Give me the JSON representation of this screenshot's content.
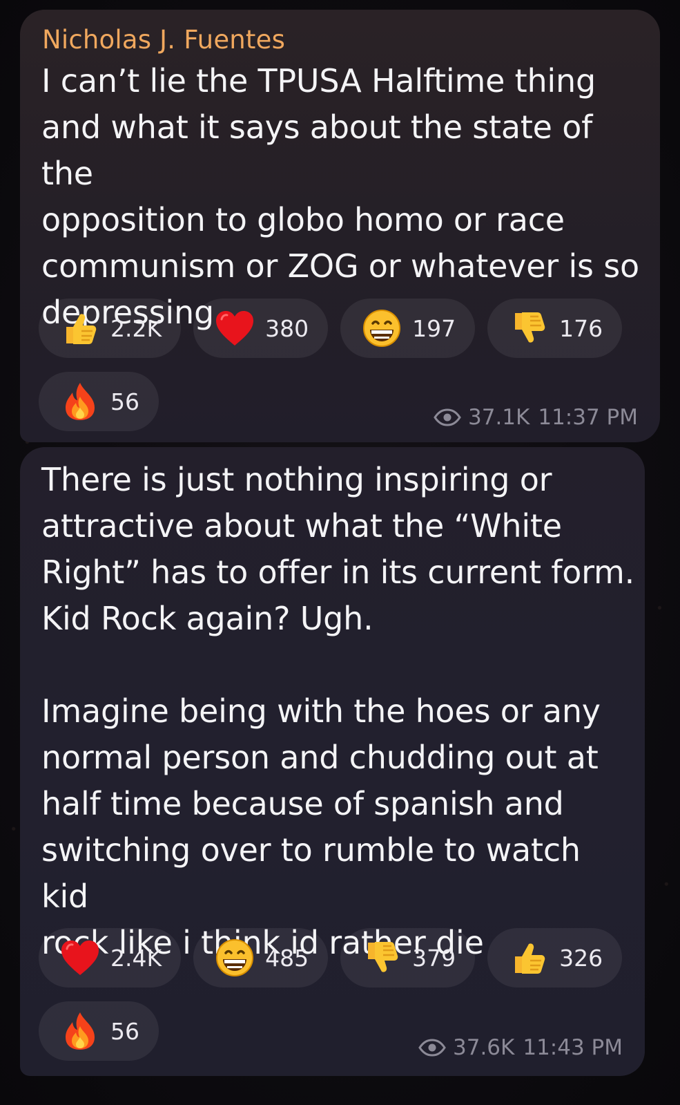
{
  "messages": [
    {
      "sender": "Nicholas J. Fuentes",
      "text": "I can’t lie the TPUSA Halftime thing\nand what it says about the state of the\nopposition to globo homo or race\ncommunism or ZOG or whatever is so\ndepressing",
      "reactions": [
        {
          "icon": "thumbs-up-icon",
          "count": "2.2K"
        },
        {
          "icon": "heart-icon",
          "count": "380"
        },
        {
          "icon": "grinning-face-icon",
          "count": "197"
        },
        {
          "icon": "thumbs-down-icon",
          "count": "176"
        },
        {
          "icon": "fire-icon",
          "count": "56"
        }
      ],
      "views": "37.1K",
      "time": "11:37 PM"
    },
    {
      "sender": "",
      "text": "There is just nothing inspiring or\nattractive about what the “White\nRight” has to offer in its current form.\nKid Rock again? Ugh.\n\nImagine being with the hoes  or any\nnormal person and chudding out at\nhalf time because of spanish and\nswitching over to rumble to watch kid\nrock like i think id rather die",
      "reactions": [
        {
          "icon": "heart-icon",
          "count": "2.4K"
        },
        {
          "icon": "grinning-face-icon",
          "count": "485"
        },
        {
          "icon": "thumbs-down-icon",
          "count": "379"
        },
        {
          "icon": "thumbs-up-icon",
          "count": "326"
        },
        {
          "icon": "fire-icon",
          "count": "56"
        }
      ],
      "views": "37.6K",
      "time": "11:43 PM"
    }
  ],
  "colors": {
    "sender_name": "#f0a85e",
    "message_text": "#f4f4f6",
    "meta_text": "#8c8a97",
    "reaction_pill": "rgba(255,255,255,0.07)"
  }
}
